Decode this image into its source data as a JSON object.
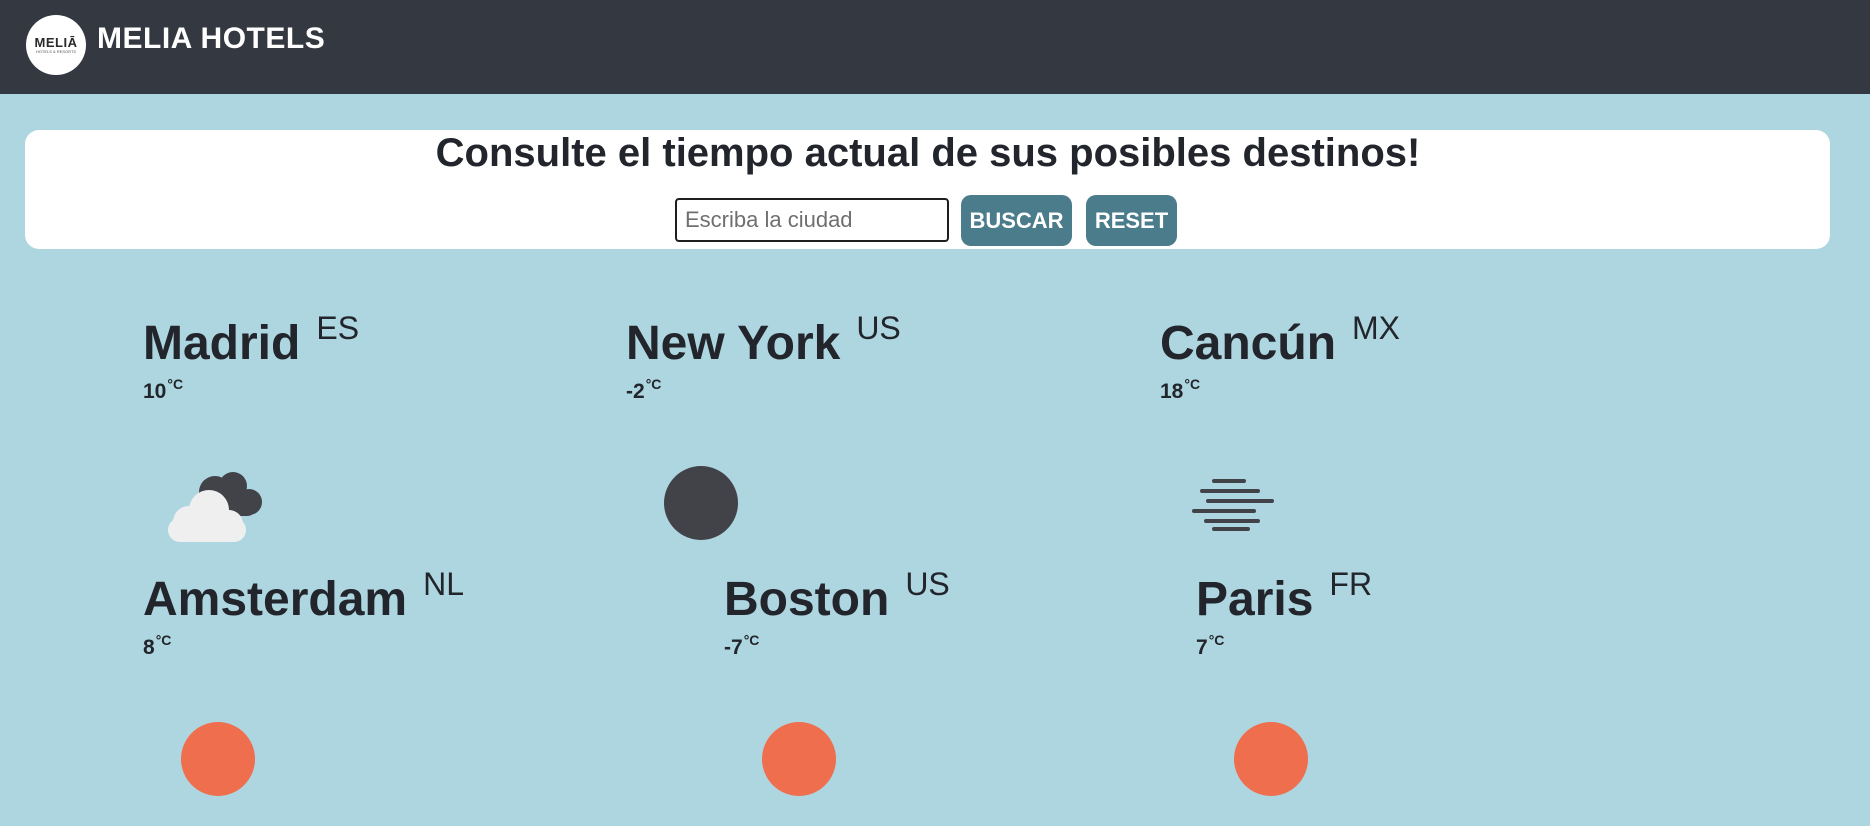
{
  "header": {
    "logo_text": "MELIĀ",
    "logo_subtext": "HOTELS & RESORTS",
    "brand": "MELIA HOTELS"
  },
  "search": {
    "title": "Consulte el tiempo actual de sus posibles destinos!",
    "placeholder": "Escriba la ciudad",
    "value": "",
    "search_label": "BUSCAR",
    "reset_label": "RESET"
  },
  "cities": [
    {
      "name": "Madrid",
      "country": "ES",
      "temp": "10",
      "unit": "°C",
      "icon": "partly-cloudy-icon"
    },
    {
      "name": "New York",
      "country": "US",
      "temp": "-2",
      "unit": "°C",
      "icon": "dark-circle-icon"
    },
    {
      "name": "Cancún",
      "country": "MX",
      "temp": "18",
      "unit": "°C",
      "icon": "fog-icon"
    },
    {
      "name": "Amsterdam",
      "country": "NL",
      "temp": "8",
      "unit": "°C",
      "icon": "sun-icon"
    },
    {
      "name": "Boston",
      "country": "US",
      "temp": "-7",
      "unit": "°C",
      "icon": "sun-icon"
    },
    {
      "name": "Paris",
      "country": "FR",
      "temp": "7",
      "unit": "°C",
      "icon": "sun-icon"
    }
  ],
  "colors": {
    "navbar": "#343840",
    "background": "#aed6e0",
    "button": "#4b7c8c",
    "sun": "#ee6e4d",
    "dark_icon": "#424349"
  }
}
